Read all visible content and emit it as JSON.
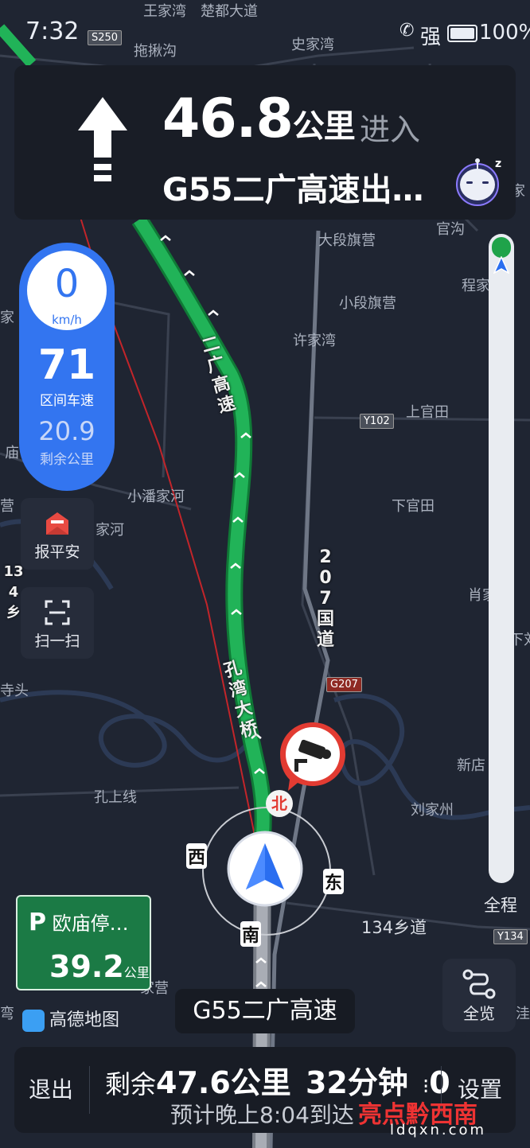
{
  "status_bar": {
    "time": "7:32",
    "signal": "强",
    "battery": "100%"
  },
  "guidance": {
    "distance_value": "46.8",
    "distance_unit": "公里",
    "action": "进入",
    "road": "G55二广高速出…",
    "icon": "straight-arrow-icon"
  },
  "speed": {
    "current": "0",
    "current_unit": "km/h",
    "section_avg": "71",
    "section_avg_label": "区间车速",
    "remaining": "20.9",
    "remaining_label": "剩余公里"
  },
  "side_buttons": {
    "safe": "报平安",
    "scan": "扫一扫"
  },
  "route_progress": {
    "label": "全程",
    "fraction": 0.01
  },
  "parking": {
    "name": "欧庙停…",
    "distance": "39.2",
    "unit": "公里"
  },
  "brand": "高德地图",
  "current_road": "G55二广高速",
  "overview_label": "全览",
  "bottom": {
    "exit": "退出",
    "remaining_prefix": "剩余",
    "remaining_distance": "47.6公里",
    "remaining_time": "32分钟",
    "traffic_lights": "0",
    "eta": "预计晚上8:04到达",
    "settings": "设置"
  },
  "compass": {
    "north": "北",
    "west": "西",
    "east": "东",
    "south": "南"
  },
  "map_labels": {
    "top1": "王家湾",
    "top2": "楚都大道",
    "p1": "拖揪沟",
    "p2": "史家湾",
    "p3": "大段旗营",
    "p4": "官沟",
    "p5": "程家",
    "p6": "小段旗营",
    "p7": "许家湾",
    "p8": "上官田",
    "p9": "小潘家河",
    "p10": "下官田",
    "p11": "家河",
    "p12": "新店",
    "p13": "刘家州",
    "p14": "孔上线",
    "p15": "肖家",
    "p16": "家营",
    "p17": "家",
    "p18": "庙",
    "p19": "营",
    "p20": "寺头",
    "p21": "弯",
    "p22": "下刘",
    "p23": "家洼",
    "p24": "家",
    "road_erguang": "二广高速",
    "road_kongwan": "孔湾大桥",
    "road_207": "207国道",
    "road_134": "134乡道",
    "road_left": "134乡"
  },
  "shields": {
    "s250": "S250",
    "y102": "Y102",
    "g207": "G207",
    "y134": "Y134"
  },
  "watermark": {
    "main": "亮点黔西南",
    "sub": "ldqxn.com"
  },
  "colors": {
    "map_bg": "#1f2532",
    "route": "#21b358",
    "accent_blue": "#3375f0",
    "parking_green": "#1b7a45",
    "camera_red": "#e23b32"
  }
}
